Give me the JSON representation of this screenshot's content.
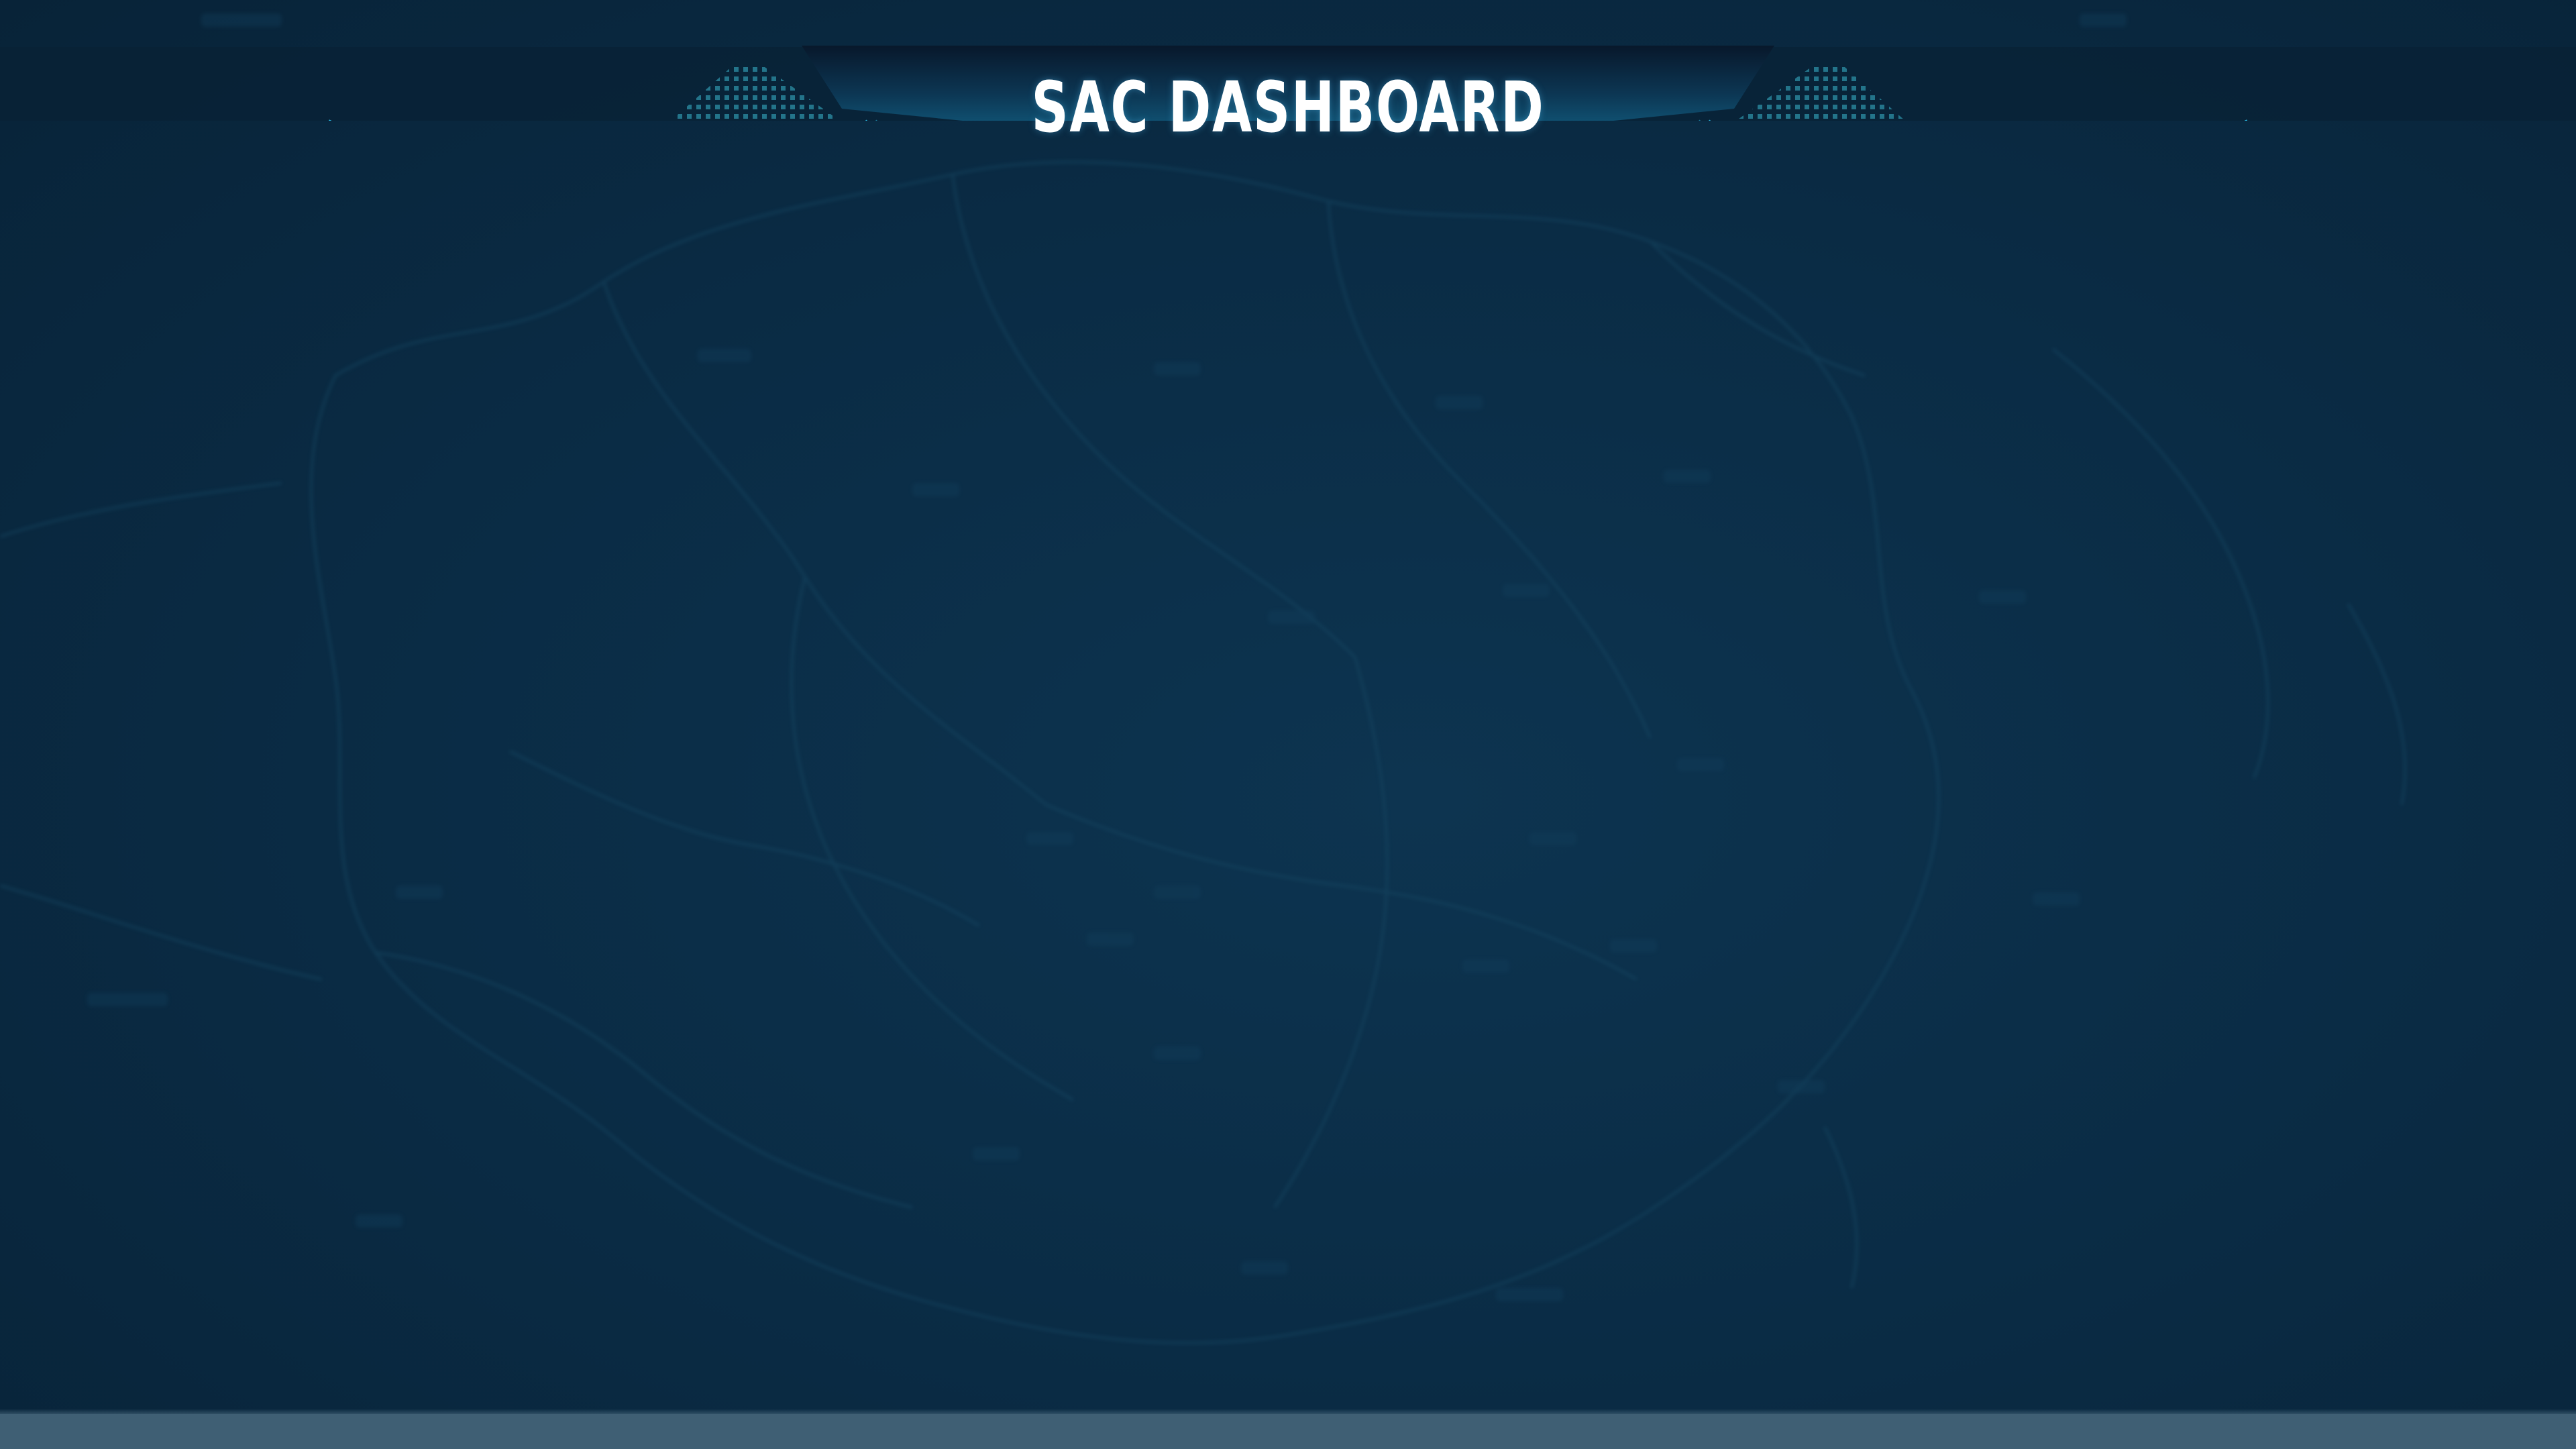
{
  "header": {
    "title": "SAC DASHBOARD"
  },
  "theme": {
    "background": "#0b2c44",
    "panel_dark": "#061a2c",
    "accent_cyan": "#29b6e0",
    "accent_glow": "#4fd3ff",
    "line_color": "#2a8fa8",
    "dots_color": "#2c8fa6",
    "footer_strip": "#3f5f74"
  },
  "icons": {
    "left_dots": "dot-grid-decoration",
    "right_dots": "dot-grid-decoration",
    "background": "blurred-map-background"
  }
}
